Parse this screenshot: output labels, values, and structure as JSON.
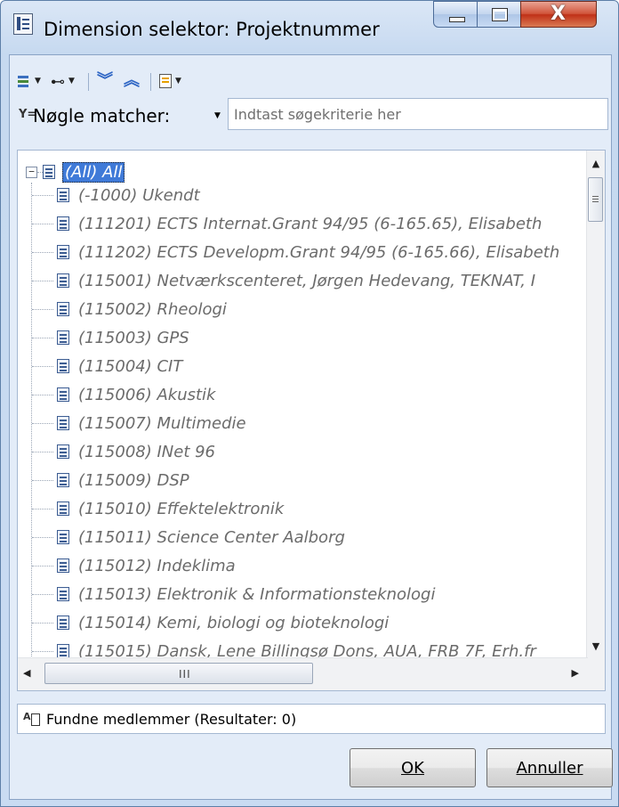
{
  "window": {
    "title": "Dimension selektor: Projektnummer",
    "close_glyph": "X"
  },
  "toolbar": {
    "icons": [
      "tree-view-icon",
      "find-icon",
      "expand-all-icon",
      "collapse-all-icon",
      "properties-icon"
    ]
  },
  "filter": {
    "label": "Nøgle matcher:",
    "placeholder": "Indtast søgekriterie her",
    "value": ""
  },
  "tree": {
    "root": {
      "label": "(All) All",
      "expanded": true,
      "selected": true
    },
    "items": [
      {
        "label": "(-1000) Ukendt"
      },
      {
        "label": "(111201) ECTS Internat.Grant 94/95 (6-165.65), Elisabeth"
      },
      {
        "label": "(111202) ECTS Developm.Grant 94/95 (6-165.66), Elisabeth"
      },
      {
        "label": "(115001) Netværkscenteret, Jørgen Hedevang, TEKNAT, I"
      },
      {
        "label": "(115002) Rheologi"
      },
      {
        "label": "(115003) GPS"
      },
      {
        "label": "(115004) CIT"
      },
      {
        "label": "(115006) Akustik"
      },
      {
        "label": "(115007) Multimedie"
      },
      {
        "label": "(115008) INet 96"
      },
      {
        "label": "(115009) DSP"
      },
      {
        "label": "(115010) Effektelektronik"
      },
      {
        "label": "(115011) Science Center Aalborg"
      },
      {
        "label": "(115012) Indeklima"
      },
      {
        "label": "(115013) Elektronik & Informationsteknologi"
      },
      {
        "label": "(115014) Kemi, biologi og bioteknologi"
      },
      {
        "label": "(115015) Dansk, Lene Billingsø Dons, AUA, FRB 7F, Erh.fr"
      }
    ]
  },
  "scrollbar": {
    "h_grip": "III"
  },
  "status": {
    "text": "Fundne medlemmer (Resultater: 0)"
  },
  "buttons": {
    "ok": "OK",
    "cancel": "Annuller"
  }
}
